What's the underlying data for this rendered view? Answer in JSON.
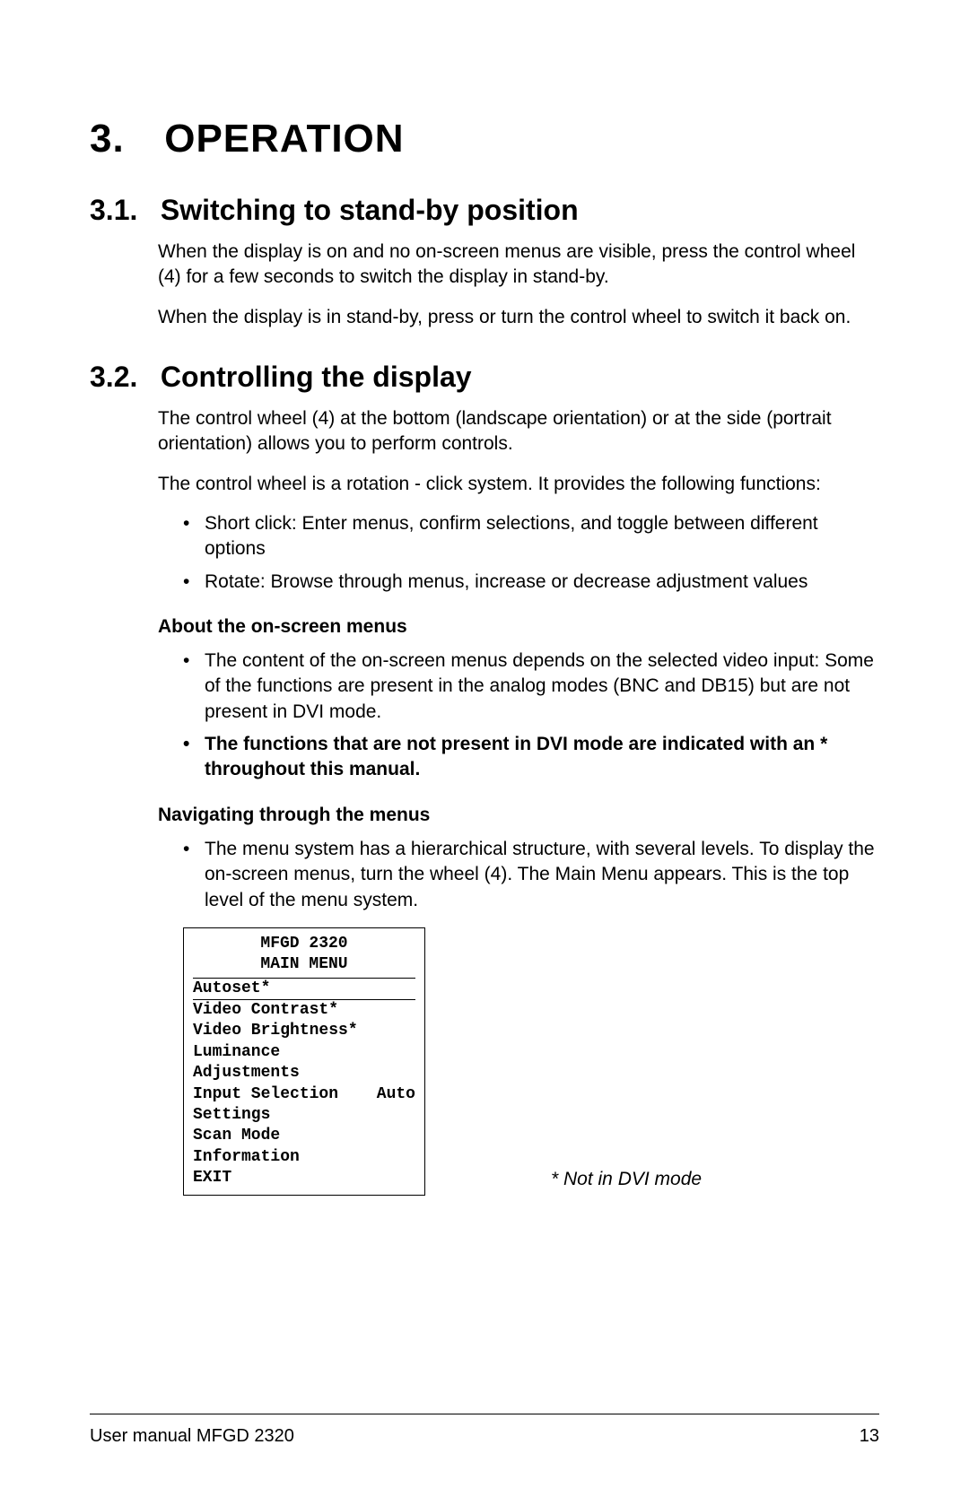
{
  "chapter": {
    "number": "3.",
    "title": "OPERATION"
  },
  "section1": {
    "number": "3.1.",
    "title": "Switching to stand-by position",
    "para1": "When the display is on and no on-screen menus are visible, press the control wheel (4) for a few seconds to switch the display in stand-by.",
    "para2": "When the display is in stand-by, press or turn the control wheel to switch it back on."
  },
  "section2": {
    "number": "3.2.",
    "title": "Controlling the display",
    "para1": "The control wheel (4) at the bottom (landscape orientation) or at the side (portrait orientation) allows you to perform controls.",
    "para2": "The control wheel is a rotation - click system. It provides the following functions:",
    "bullets1": [
      "Short click: Enter menus, confirm selections, and toggle between different options",
      "Rotate: Browse through menus, increase or decrease adjustment values"
    ],
    "sub1": {
      "title": "About the on-screen menus",
      "bullet1": "The content of the on-screen menus depends on the selected video input: Some of the functions are present in the analog modes (BNC and DB15) but are not present in DVI mode.",
      "bullet2": "The functions that are not present in DVI mode are indicated with an * throughout this manual."
    },
    "sub2": {
      "title": "Navigating through the menus",
      "bullet1": "The menu system has a hierarchical structure, with several levels. To display the on-screen menus, turn the wheel (4). The Main Menu appears. This is the top level of the menu system."
    }
  },
  "menu": {
    "title1": "MFGD 2320",
    "title2": "MAIN MENU",
    "selected": "Autoset*",
    "items": [
      "Video Contrast*",
      "Video Brightness*",
      "Luminance",
      "Adjustments"
    ],
    "inputSelection": {
      "label": "Input Selection",
      "value": "Auto"
    },
    "items2": [
      "Settings",
      "Scan Mode",
      "Information",
      "EXIT"
    ]
  },
  "note": "* Not in DVI mode",
  "footer": {
    "left": "User manual MFGD 2320",
    "right": "13"
  }
}
